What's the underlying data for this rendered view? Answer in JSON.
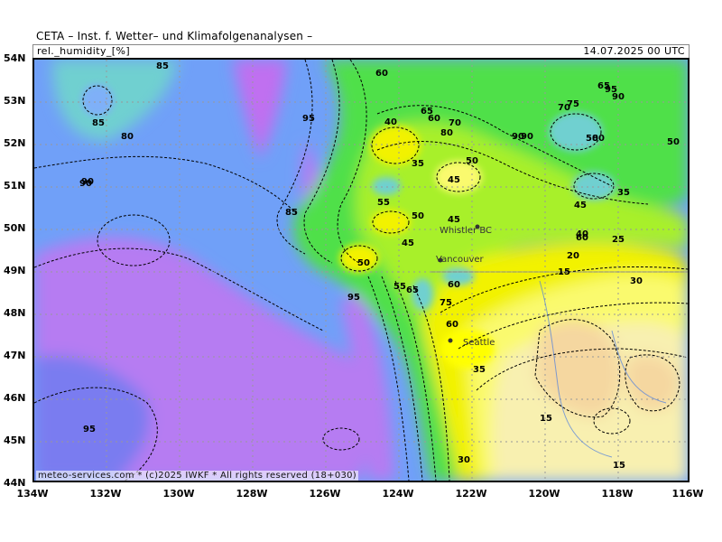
{
  "title": "CETA – Inst. f. Wetter– und Klimafolgenanalysen –",
  "header": {
    "parameter": "rel._humidity_[%]",
    "valid_time": "14.07.2025 00 UTC"
  },
  "credit": "meteo-services.com * (c)2025 IWKF * All rights reserved (18+030)",
  "lat_labels": [
    "54N",
    "53N",
    "52N",
    "51N",
    "50N",
    "49N",
    "48N",
    "47N",
    "46N",
    "45N",
    "44N"
  ],
  "lon_labels": [
    "134W",
    "132W",
    "130W",
    "128W",
    "126W",
    "124W",
    "122W",
    "120W",
    "118W",
    "116W"
  ],
  "cities": [
    {
      "name": "Whistler BC"
    },
    {
      "name": "Vancouver"
    },
    {
      "name": "Seattle"
    }
  ],
  "contour_labels": [
    "85",
    "90",
    "85",
    "80",
    "90",
    "95",
    "60",
    "65",
    "70",
    "60",
    "75",
    "70",
    "80",
    "90",
    "65",
    "95",
    "90",
    "40",
    "35",
    "50",
    "45",
    "80",
    "55",
    "50",
    "45",
    "45",
    "60",
    "25",
    "50",
    "30",
    "15",
    "20",
    "40",
    "35",
    "50",
    "55",
    "65",
    "95",
    "75",
    "60",
    "35",
    "15",
    "30",
    "15",
    "95",
    "90",
    "85",
    "60",
    "50",
    "45"
  ],
  "colors": {
    "rh_15": "#f5d7a0",
    "rh_20": "#f8f0b0",
    "rh_30": "#fafa6e",
    "rh_40": "#f2f200",
    "rh_50": "#a8f02a",
    "rh_60": "#4fe04a",
    "rh_70": "#22c060",
    "rh_80": "#6fd0d0",
    "rh_90": "#70a0f8",
    "rh_95": "#7a7cf0",
    "rh_100": "#c070f0"
  }
}
